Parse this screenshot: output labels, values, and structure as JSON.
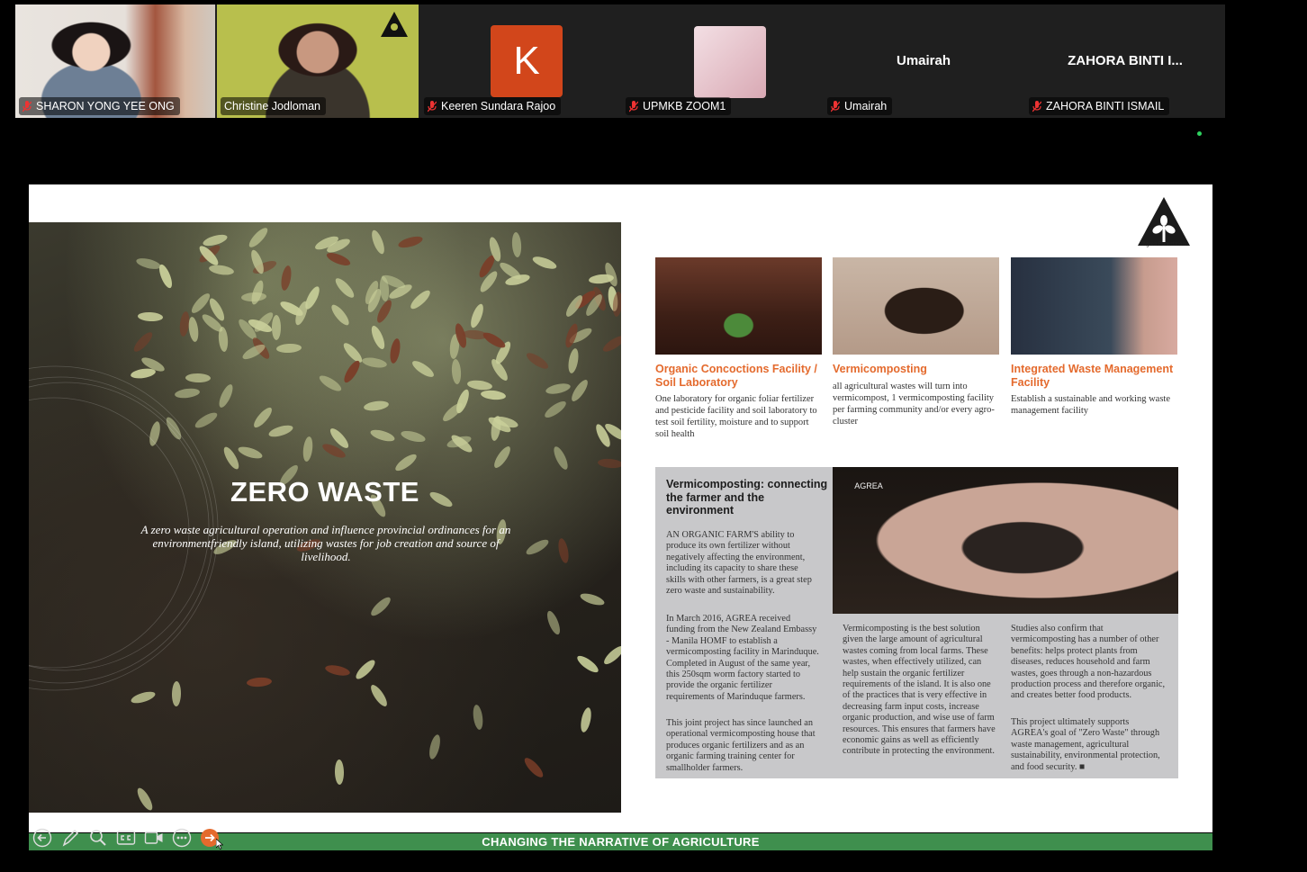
{
  "participants": [
    {
      "name": "SHARON YONG YEE ONG",
      "muted": true
    },
    {
      "name": "Christine Jodloman",
      "muted": false,
      "active": true
    },
    {
      "name": "Keeren Sundara Rajoo",
      "muted": true,
      "avatar_letter": "K"
    },
    {
      "name": "UPMKB ZOOM1",
      "muted": true
    },
    {
      "name": "Umairah",
      "muted": true,
      "display_name": "Umairah"
    },
    {
      "name": "ZAHORA BINTI ISMAIL",
      "muted": true,
      "display_name": "ZAHORA BINTI I..."
    }
  ],
  "colors": {
    "active_border": "#2ed15f",
    "accent_orange": "#e46a2d",
    "footer_green": "#3f8f4e",
    "k_avatar": "#d2461b"
  },
  "slide": {
    "title": "ZERO WASTE",
    "subtitle": "A zero waste agricultural operation and influence provincial ordinances for an environmentfriendly island, utilizing wastes for job creation and source of livelihood.",
    "logo_text": "Agrea Foundation",
    "features": [
      {
        "title": "Organic Concoctions Facility / Soil Laboratory",
        "body": "One laboratory for organic foliar fertilizer and pesticide facility and soil laboratory to test soil fertility, moisture and to support soil health"
      },
      {
        "title": "Vermicomposting",
        "body": "all agricultural wastes will turn into vermicompost, 1 vermicomposting facility per farming community and/or every agro-cluster"
      },
      {
        "title": "Integrated Waste Management Facility",
        "body": "Establish a sustainable and working waste management facility"
      }
    ],
    "article": {
      "title": "Vermicomposting: connecting the farmer and the environment",
      "photo_mark": "AGREA",
      "col1_p1": "AN ORGANIC FARM'S ability to produce its own fertilizer without negatively affecting the environment, including its capacity to share these skills with other farmers, is a great step zero waste and sustainability.",
      "col1_p2": "In March 2016, AGREA received funding from the New Zealand Embassy - Manila HOMF to establish a vermicomposting facility in Marinduque. Completed in August of the same year, this 250sqm worm factory started to provide the organic fertilizer requirements of Marinduque farmers.",
      "col1_p3": "This joint project has since launched an operational vermicomposting house that produces organic fertilizers and as an organic farming training center for smallholder farmers.",
      "col2": "Vermicomposting is the best solution given the large amount of agricultural wastes coming from local farms. These wastes, when effectively utilized, can help sustain the organic fertilizer requirements of the island. It is also one of the practices that is very effective in decreasing farm input costs, increase organic production, and wise use of farm resources. This ensures that farmers have economic gains as well as efficiently contribute in protecting the environment.",
      "col3_p1": "Studies also confirm that vermicomposting has a number of other benefits: helps protect plants from diseases, reduces household and farm wastes, goes through a non-hazardous production process and therefore organic, and creates better food products.",
      "col3_p2": "This project ultimately supports AGREA's goal of \"Zero Waste\" through waste management, agricultural sustainability, environmental protection, and food security. ■"
    },
    "footer": "CHANGING THE NARRATIVE OF AGRICULTURE"
  },
  "toolbar": [
    "previous-slide",
    "pen",
    "zoom",
    "subtitles",
    "camera",
    "more",
    "next-slide"
  ]
}
